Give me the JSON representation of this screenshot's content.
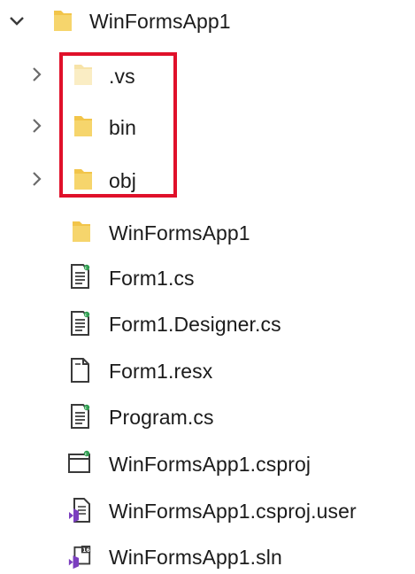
{
  "tree": {
    "root": {
      "label": "WinFormsApp1",
      "expanded": true,
      "icon": "folder-icon"
    },
    "items": [
      {
        "label": ".vs",
        "type": "folder",
        "icon": "folder-faded-icon",
        "collapsed": true
      },
      {
        "label": "bin",
        "type": "folder",
        "icon": "folder-icon",
        "collapsed": true
      },
      {
        "label": "obj",
        "type": "folder",
        "icon": "folder-icon",
        "collapsed": true
      },
      {
        "label": "WinFormsApp1",
        "type": "folder",
        "icon": "folder-icon"
      },
      {
        "label": "Form1.cs",
        "type": "file",
        "icon": "csharp-file-icon"
      },
      {
        "label": "Form1.Designer.cs",
        "type": "file",
        "icon": "csharp-file-icon"
      },
      {
        "label": "Form1.resx",
        "type": "file",
        "icon": "resource-file-icon"
      },
      {
        "label": "Program.cs",
        "type": "file",
        "icon": "csharp-file-icon"
      },
      {
        "label": "WinFormsApp1.csproj",
        "type": "file",
        "icon": "csproj-file-icon"
      },
      {
        "label": "WinFormsApp1.csproj.user",
        "type": "file",
        "icon": "user-file-icon"
      },
      {
        "label": "WinFormsApp1.sln",
        "type": "file",
        "icon": "solution-file-icon"
      }
    ]
  },
  "colors": {
    "highlight": "#e0102a",
    "folder": "#f2c54a",
    "chevron": "#6b6b6b",
    "vs_purple": "#7b3fbf"
  }
}
